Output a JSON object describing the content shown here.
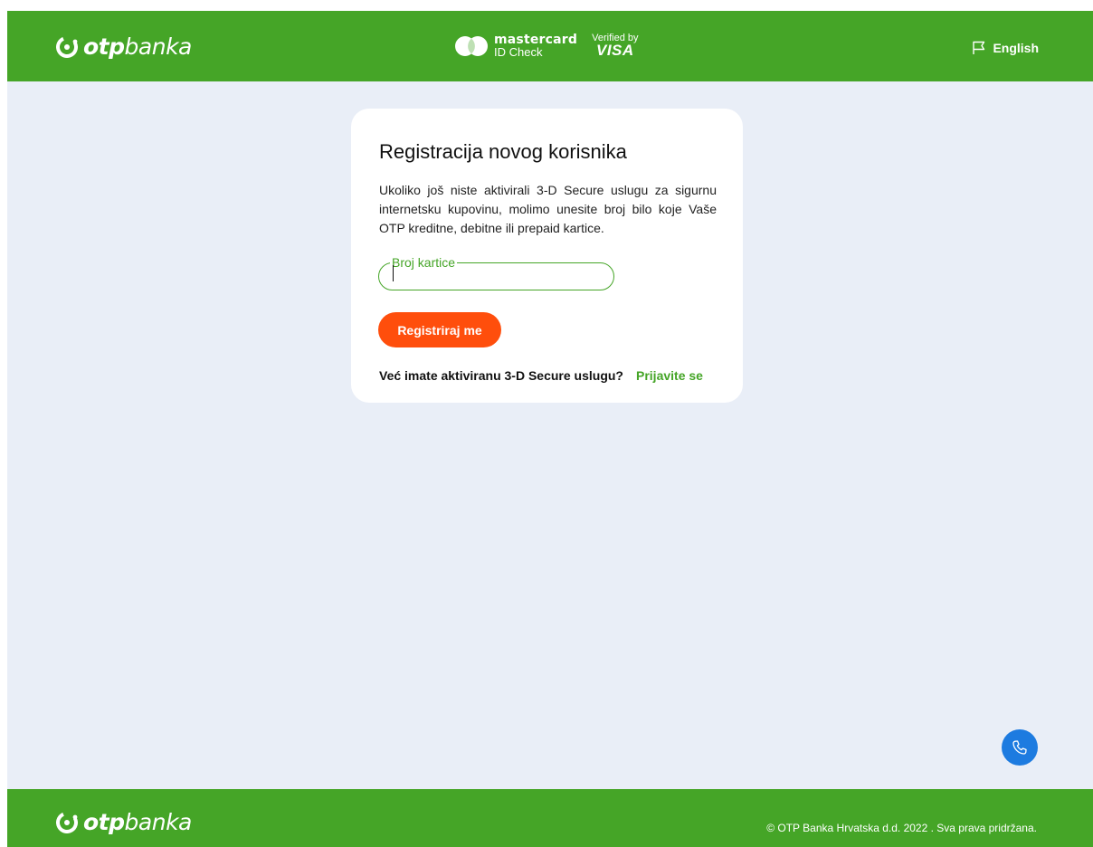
{
  "colors": {
    "brand_green": "#45a527",
    "accent_orange": "#ff4e0c",
    "background": "#e9eef7",
    "link_green": "#45a527",
    "fab_blue": "#1d7be0"
  },
  "header": {
    "logo": {
      "bold": "otp",
      "regular": "banka",
      "icon": "otp-logo-icon"
    },
    "mastercard": {
      "name": "mastercard",
      "sub": "ID Check"
    },
    "visa": {
      "top": "Verified by",
      "name": "VISA"
    },
    "language": {
      "label": "English",
      "icon": "flag-icon"
    }
  },
  "card": {
    "title": "Registracija novog korisnika",
    "description": "Ukoliko još niste aktivirali 3-D Secure uslugu za sigurnu internetsku kupovinu, molimo unesite broj bilo koje Vaše OTP kreditne, debitne ili prepaid kartice.",
    "card_number_field": {
      "label": "Broj kartice",
      "value": "",
      "placeholder": ""
    },
    "register_button": "Registriraj me",
    "login_prompt": "Već imate aktiviranu 3-D Secure uslugu?",
    "login_link": "Prijavite se"
  },
  "fab": {
    "icon": "phone-icon"
  },
  "footer": {
    "logo": {
      "bold": "otp",
      "regular": "banka",
      "icon": "otp-logo-icon"
    },
    "copyright": "© OTP Banka Hrvatska d.d. 2022 . Sva prava pridržana."
  }
}
